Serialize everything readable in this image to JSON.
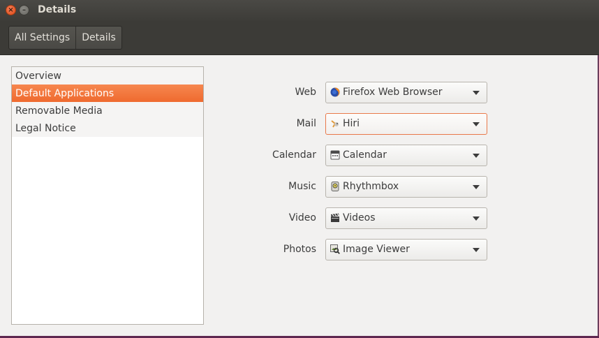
{
  "window": {
    "title": "Details"
  },
  "breadcrumbs": [
    "All Settings",
    "Details"
  ],
  "sidebar": {
    "items": [
      {
        "label": "Overview",
        "selected": false
      },
      {
        "label": "Default Applications",
        "selected": true
      },
      {
        "label": "Removable Media",
        "selected": false
      },
      {
        "label": "Legal Notice",
        "selected": false
      }
    ]
  },
  "defaults": [
    {
      "label": "Web",
      "value": "Firefox Web Browser",
      "icon": "firefox-icon"
    },
    {
      "label": "Mail",
      "value": "Hiri",
      "icon": "hiri-icon"
    },
    {
      "label": "Calendar",
      "value": "Calendar",
      "icon": "calendar-icon"
    },
    {
      "label": "Music",
      "value": "Rhythmbox",
      "icon": "rhythmbox-icon"
    },
    {
      "label": "Video",
      "value": "Videos",
      "icon": "videos-icon"
    },
    {
      "label": "Photos",
      "value": "Image Viewer",
      "icon": "image-viewer-icon"
    }
  ],
  "colors": {
    "accent": "#ef6a2f",
    "titlebar": "#3c3b37"
  }
}
